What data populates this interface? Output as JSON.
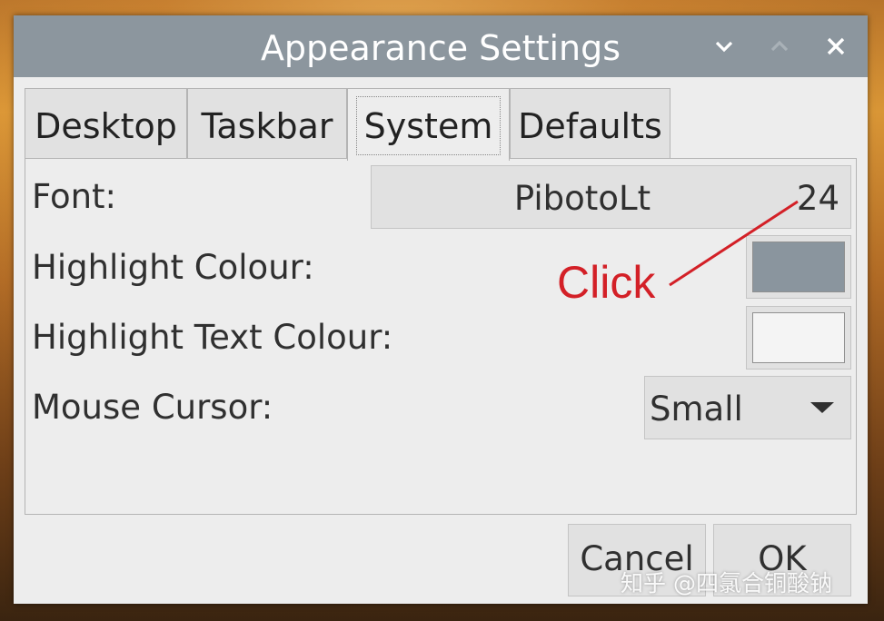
{
  "window": {
    "title": "Appearance Settings",
    "controls": {
      "minimize_icon": "chevron-down-icon",
      "maximize_icon": "chevron-up-icon",
      "close_icon": "close-icon"
    }
  },
  "tabs": [
    {
      "label": "Desktop",
      "active": false
    },
    {
      "label": "Taskbar",
      "active": false
    },
    {
      "label": "System",
      "active": true
    },
    {
      "label": "Defaults",
      "active": false
    }
  ],
  "system": {
    "font_label": "Font:",
    "font_name": "PibotoLt",
    "font_size": "24",
    "highlight_colour_label": "Highlight Colour:",
    "highlight_colour_value": "#8a959e",
    "highlight_text_colour_label": "Highlight Text Colour:",
    "highlight_text_colour_value": "#f4f4f4",
    "mouse_cursor_label": "Mouse Cursor:",
    "mouse_cursor_value": "Small"
  },
  "buttons": {
    "cancel": "Cancel",
    "ok": "OK"
  },
  "annotation": {
    "text": "Click",
    "color": "#d32027"
  },
  "watermark": "知乎 @四氯合铜酸钠",
  "colors": {
    "titlebar": "#8c969e",
    "window_bg": "#ededed",
    "button_bg": "#e1e1e1"
  }
}
